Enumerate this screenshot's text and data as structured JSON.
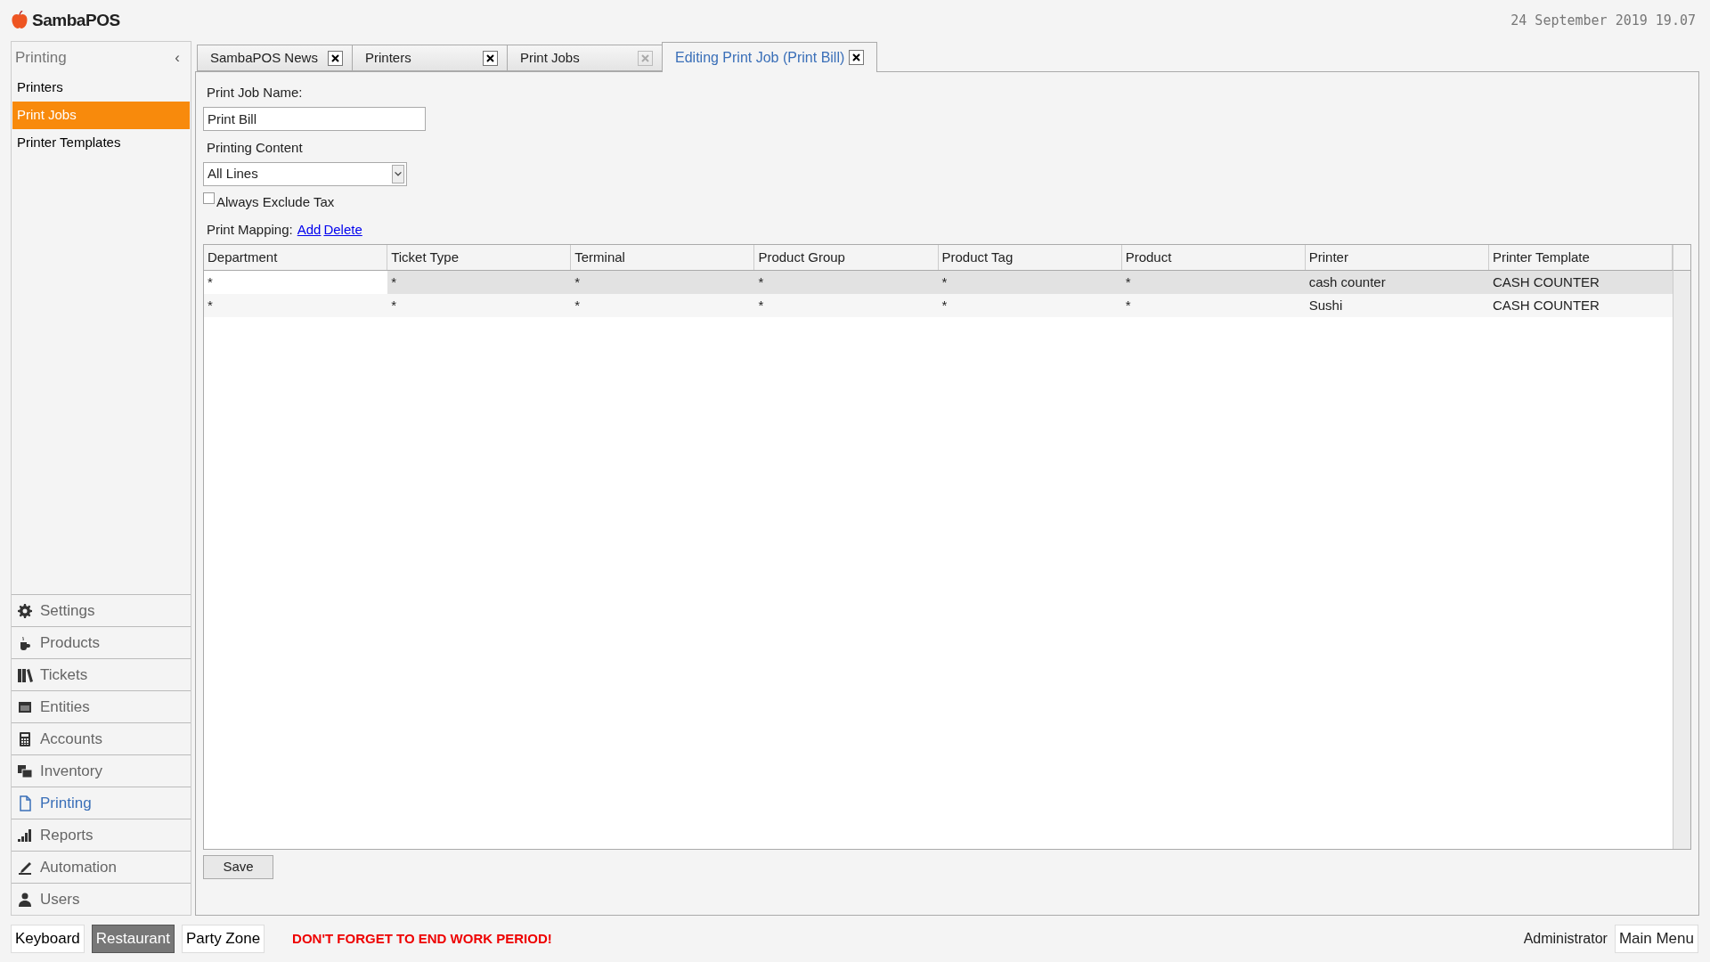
{
  "app": {
    "logo": "SambaPOS",
    "datetime": "24 September 2019 19.07"
  },
  "sidebar": {
    "title": "Printing",
    "collapse": "‹",
    "items": [
      {
        "label": "Printers",
        "selected": false
      },
      {
        "label": "Print Jobs",
        "selected": true
      },
      {
        "label": "Printer Templates",
        "selected": false
      }
    ],
    "nav": [
      {
        "label": "Settings",
        "selected": false
      },
      {
        "label": "Products",
        "selected": false
      },
      {
        "label": "Tickets",
        "selected": false
      },
      {
        "label": "Entities",
        "selected": false
      },
      {
        "label": "Accounts",
        "selected": false
      },
      {
        "label": "Inventory",
        "selected": false
      },
      {
        "label": "Printing",
        "selected": true
      },
      {
        "label": "Reports",
        "selected": false
      },
      {
        "label": "Automation",
        "selected": false
      },
      {
        "label": "Users",
        "selected": false
      }
    ]
  },
  "tabs": [
    {
      "label": "SambaPOS News",
      "selected": false,
      "close_disabled": false
    },
    {
      "label": "Printers",
      "selected": false,
      "close_disabled": false
    },
    {
      "label": "Print Jobs",
      "selected": false,
      "close_disabled": true
    },
    {
      "label": "Editing Print Job (Print Bill)",
      "selected": true,
      "close_disabled": false
    }
  ],
  "form": {
    "name_label": "Print Job Name:",
    "name_value": "Print Bill",
    "content_label": "Printing Content",
    "content_value": "All Lines",
    "exclude_tax": {
      "label": "Always Exclude Tax",
      "checked": false
    },
    "mapping_label": "Print Mapping:",
    "add_link": "Add",
    "delete_link": "Delete",
    "save_button": "Save"
  },
  "table": {
    "columns": [
      "Department",
      "Ticket Type",
      "Terminal",
      "Product Group",
      "Product Tag",
      "Product",
      "Printer",
      "Printer Template"
    ],
    "rows": [
      {
        "selected": true,
        "cells": [
          "*",
          "*",
          "*",
          "*",
          "*",
          "*",
          "cash counter",
          "CASH COUNTER"
        ]
      },
      {
        "selected": false,
        "cells": [
          "*",
          "*",
          "*",
          "*",
          "*",
          "*",
          "Sushi",
          "CASH COUNTER"
        ]
      }
    ]
  },
  "status_bar": {
    "departments": [
      {
        "label": "Keyboard",
        "selected": false
      },
      {
        "label": "Restaurant",
        "selected": true
      },
      {
        "label": "Party Zone",
        "selected": false
      }
    ],
    "warning": "DON'T FORGET TO END WORK PERIOD!",
    "user": "Administrator",
    "main_menu": "Main Menu"
  }
}
